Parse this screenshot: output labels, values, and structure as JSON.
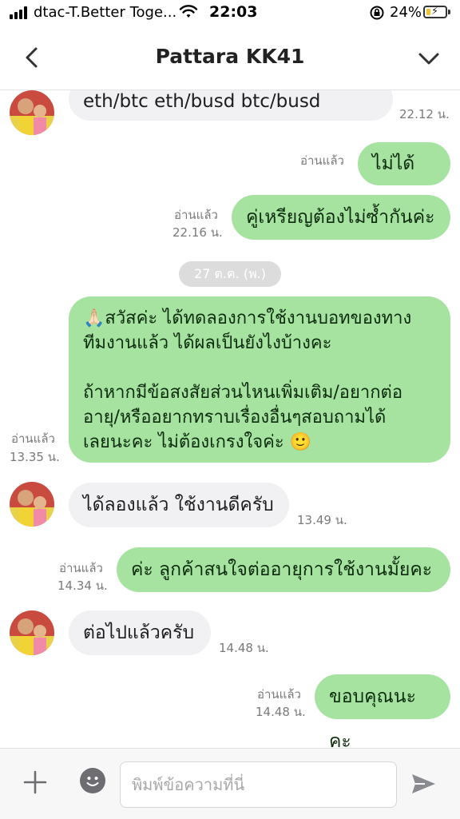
{
  "status_bar": {
    "carrier": "dtac-T.Better Toge...",
    "time": "22:03",
    "battery_percent": "24%",
    "battery_level": 0.24
  },
  "header": {
    "title": "Pattara KK41"
  },
  "messages": [
    {
      "direction": "in",
      "text": "eth/btc eth/busd btc/busd",
      "time": "22.12 น."
    },
    {
      "direction": "out",
      "text": "ไม่ได้ค่ะ",
      "read": "อ่านแล้ว",
      "time": ""
    },
    {
      "direction": "out",
      "text": "คู่เหรียญต้องไม่ซ้ำกันค่ะ",
      "read": "อ่านแล้ว",
      "time": "22.16 น."
    },
    {
      "direction": "out",
      "lines": [
        "🙏🏻สวัสค่ะ ได้ทดลองการใช้งานบอทของทาง",
        "ทีมงานแล้ว ได้ผลเป็นยังไงบ้างคะ",
        "",
        "ถ้าหากมีข้อสงสัยส่วนไหนเพิ่มเติม/อยากต่อ",
        "อายุ/หรืออยากทราบเรื่องอื่นๆสอบถามได้",
        "เลยนะคะ ไม่ต้องเกรงใจค่ะ 🙂"
      ],
      "read": "อ่านแล้ว",
      "time": "13.35 น."
    },
    {
      "direction": "in",
      "text": "ได้ลองแล้ว ใช้งานดีครับ",
      "time": "13.49 น."
    },
    {
      "direction": "out",
      "text": "ค่ะ ลูกค้าสนใจต่ออายุการใช้งานมั้ยคะ",
      "read": "อ่านแล้ว",
      "time": "14.34 น."
    },
    {
      "direction": "in",
      "text": "ต่อไปแล้วครับ",
      "time": "14.48 น."
    },
    {
      "direction": "out",
      "text": "ขอบคุณนะคะ",
      "read": "อ่านแล้ว",
      "time": "14.48 น."
    }
  ],
  "date_separator": "27 ต.ค. (พ.)",
  "input": {
    "placeholder": "พิมพ์ข้อความที่นี่"
  },
  "icons": {
    "back": "chevron-left-icon",
    "menu": "chevron-down-icon",
    "add": "plus-icon",
    "emoji": "emoji-icon",
    "send": "send-icon"
  },
  "colors": {
    "outgoing_bubble": "#a6e3a1",
    "incoming_bubble": "#f1f1f3"
  }
}
